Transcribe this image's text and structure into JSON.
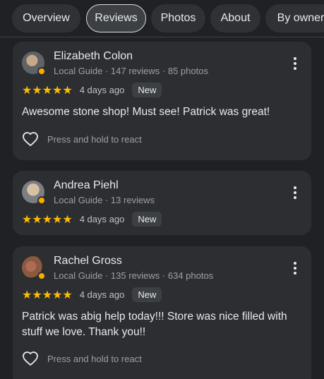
{
  "tabs": [
    {
      "label": "Overview"
    },
    {
      "label": "Reviews",
      "active": true
    },
    {
      "label": "Photos"
    },
    {
      "label": "About"
    },
    {
      "label": "By owner"
    }
  ],
  "reviews": [
    {
      "name": "Elizabeth Colon",
      "meta": "Local Guide · 147 reviews · 85 photos",
      "stars": "★★★★★",
      "time": "4 days ago",
      "badge": "New",
      "text": "Awesome stone shop! Must see! Patrick was great!",
      "react": "Press and hold to react"
    },
    {
      "name": "Andrea Piehl",
      "meta": "Local Guide · 13 reviews",
      "stars": "★★★★★",
      "time": "4 days ago",
      "badge": "New"
    },
    {
      "name": "Rachel Gross",
      "meta": "Local Guide · 135 reviews · 634 photos",
      "stars": "★★★★★",
      "time": "4 days ago",
      "badge": "New",
      "text": "Patrick was abig help today!!! Store was nice filled with stuff we love. Thank you!!",
      "react": "Press and hold to react"
    }
  ],
  "colors": {
    "star": "#fbbc04",
    "guide_badge": "#f9ab00",
    "card": "#2d2e31",
    "background": "#202124"
  }
}
